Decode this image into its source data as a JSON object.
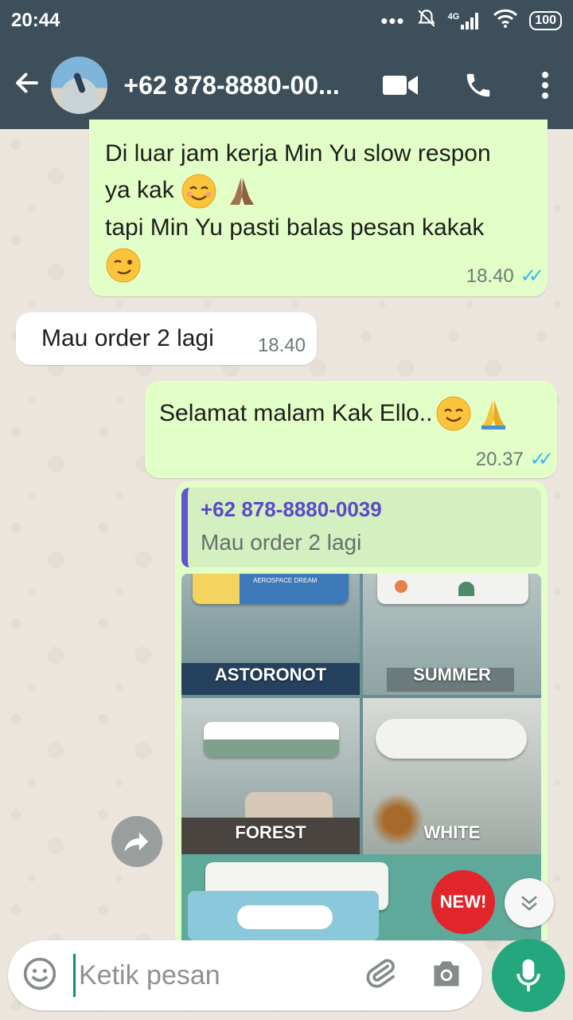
{
  "status_bar": {
    "time": "20:44",
    "dots": "•••",
    "network": "4G",
    "battery": "100"
  },
  "header": {
    "contact_name": "+62 878-8880-00..."
  },
  "messages": [
    {
      "direction": "outgoing",
      "lines": [
        "Di luar jam kerja Min Yu slow respon",
        "ya kak",
        "tapi Min Yu pasti balas pesan kakak"
      ],
      "time": "18.40",
      "ticks": "✓✓"
    },
    {
      "direction": "incoming",
      "text": "Mau order 2 lagi",
      "time": "18.40"
    },
    {
      "direction": "outgoing",
      "text": "Selamat malam Kak Ello..",
      "time": "20.37",
      "ticks": "✓✓"
    },
    {
      "direction": "outgoing",
      "quote": {
        "name": "+62 878-8880-0039",
        "text": "Mau order 2 lagi"
      },
      "photo_labels": [
        "AEROSPACE DREAM",
        "ASTORONOT",
        "SUMMER",
        "FOREST",
        "WHITE",
        "NEW!"
      ]
    }
  ],
  "input": {
    "placeholder": "Ketik pesan"
  },
  "colors": {
    "header": "#3d4f5a",
    "outgoing_bubble": "#e2ffc7",
    "incoming_bubble": "#ffffff",
    "accent": "#25a77e",
    "read_ticks": "#34b7f1",
    "quote_bar": "#6355cf"
  },
  "icons": [
    "back-arrow-icon",
    "video-call-icon",
    "voice-call-icon",
    "more-options-icon",
    "forward-icon",
    "scroll-down-icon",
    "emoji-icon",
    "attach-icon",
    "camera-icon",
    "mic-icon"
  ]
}
